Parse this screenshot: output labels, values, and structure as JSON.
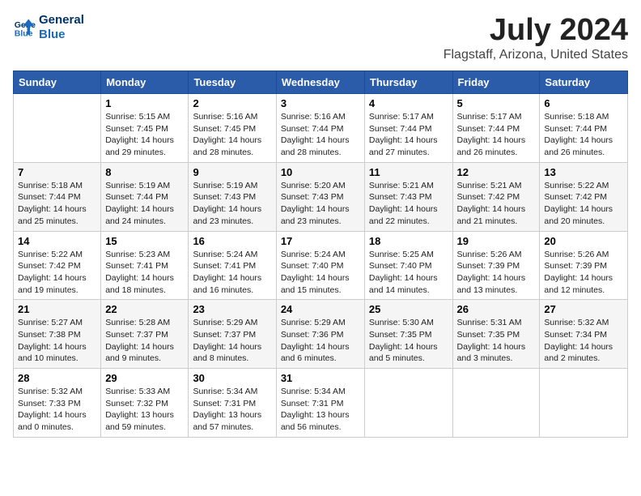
{
  "logo": {
    "line1": "General",
    "line2": "Blue"
  },
  "title": "July 2024",
  "subtitle": "Flagstaff, Arizona, United States",
  "days_of_week": [
    "Sunday",
    "Monday",
    "Tuesday",
    "Wednesday",
    "Thursday",
    "Friday",
    "Saturday"
  ],
  "weeks": [
    [
      {
        "day": "",
        "info": ""
      },
      {
        "day": "1",
        "info": "Sunrise: 5:15 AM\nSunset: 7:45 PM\nDaylight: 14 hours\nand 29 minutes."
      },
      {
        "day": "2",
        "info": "Sunrise: 5:16 AM\nSunset: 7:45 PM\nDaylight: 14 hours\nand 28 minutes."
      },
      {
        "day": "3",
        "info": "Sunrise: 5:16 AM\nSunset: 7:44 PM\nDaylight: 14 hours\nand 28 minutes."
      },
      {
        "day": "4",
        "info": "Sunrise: 5:17 AM\nSunset: 7:44 PM\nDaylight: 14 hours\nand 27 minutes."
      },
      {
        "day": "5",
        "info": "Sunrise: 5:17 AM\nSunset: 7:44 PM\nDaylight: 14 hours\nand 26 minutes."
      },
      {
        "day": "6",
        "info": "Sunrise: 5:18 AM\nSunset: 7:44 PM\nDaylight: 14 hours\nand 26 minutes."
      }
    ],
    [
      {
        "day": "7",
        "info": "Sunrise: 5:18 AM\nSunset: 7:44 PM\nDaylight: 14 hours\nand 25 minutes."
      },
      {
        "day": "8",
        "info": "Sunrise: 5:19 AM\nSunset: 7:44 PM\nDaylight: 14 hours\nand 24 minutes."
      },
      {
        "day": "9",
        "info": "Sunrise: 5:19 AM\nSunset: 7:43 PM\nDaylight: 14 hours\nand 23 minutes."
      },
      {
        "day": "10",
        "info": "Sunrise: 5:20 AM\nSunset: 7:43 PM\nDaylight: 14 hours\nand 23 minutes."
      },
      {
        "day": "11",
        "info": "Sunrise: 5:21 AM\nSunset: 7:43 PM\nDaylight: 14 hours\nand 22 minutes."
      },
      {
        "day": "12",
        "info": "Sunrise: 5:21 AM\nSunset: 7:42 PM\nDaylight: 14 hours\nand 21 minutes."
      },
      {
        "day": "13",
        "info": "Sunrise: 5:22 AM\nSunset: 7:42 PM\nDaylight: 14 hours\nand 20 minutes."
      }
    ],
    [
      {
        "day": "14",
        "info": "Sunrise: 5:22 AM\nSunset: 7:42 PM\nDaylight: 14 hours\nand 19 minutes."
      },
      {
        "day": "15",
        "info": "Sunrise: 5:23 AM\nSunset: 7:41 PM\nDaylight: 14 hours\nand 18 minutes."
      },
      {
        "day": "16",
        "info": "Sunrise: 5:24 AM\nSunset: 7:41 PM\nDaylight: 14 hours\nand 16 minutes."
      },
      {
        "day": "17",
        "info": "Sunrise: 5:24 AM\nSunset: 7:40 PM\nDaylight: 14 hours\nand 15 minutes."
      },
      {
        "day": "18",
        "info": "Sunrise: 5:25 AM\nSunset: 7:40 PM\nDaylight: 14 hours\nand 14 minutes."
      },
      {
        "day": "19",
        "info": "Sunrise: 5:26 AM\nSunset: 7:39 PM\nDaylight: 14 hours\nand 13 minutes."
      },
      {
        "day": "20",
        "info": "Sunrise: 5:26 AM\nSunset: 7:39 PM\nDaylight: 14 hours\nand 12 minutes."
      }
    ],
    [
      {
        "day": "21",
        "info": "Sunrise: 5:27 AM\nSunset: 7:38 PM\nDaylight: 14 hours\nand 10 minutes."
      },
      {
        "day": "22",
        "info": "Sunrise: 5:28 AM\nSunset: 7:37 PM\nDaylight: 14 hours\nand 9 minutes."
      },
      {
        "day": "23",
        "info": "Sunrise: 5:29 AM\nSunset: 7:37 PM\nDaylight: 14 hours\nand 8 minutes."
      },
      {
        "day": "24",
        "info": "Sunrise: 5:29 AM\nSunset: 7:36 PM\nDaylight: 14 hours\nand 6 minutes."
      },
      {
        "day": "25",
        "info": "Sunrise: 5:30 AM\nSunset: 7:35 PM\nDaylight: 14 hours\nand 5 minutes."
      },
      {
        "day": "26",
        "info": "Sunrise: 5:31 AM\nSunset: 7:35 PM\nDaylight: 14 hours\nand 3 minutes."
      },
      {
        "day": "27",
        "info": "Sunrise: 5:32 AM\nSunset: 7:34 PM\nDaylight: 14 hours\nand 2 minutes."
      }
    ],
    [
      {
        "day": "28",
        "info": "Sunrise: 5:32 AM\nSunset: 7:33 PM\nDaylight: 14 hours\nand 0 minutes."
      },
      {
        "day": "29",
        "info": "Sunrise: 5:33 AM\nSunset: 7:32 PM\nDaylight: 13 hours\nand 59 minutes."
      },
      {
        "day": "30",
        "info": "Sunrise: 5:34 AM\nSunset: 7:31 PM\nDaylight: 13 hours\nand 57 minutes."
      },
      {
        "day": "31",
        "info": "Sunrise: 5:34 AM\nSunset: 7:31 PM\nDaylight: 13 hours\nand 56 minutes."
      },
      {
        "day": "",
        "info": ""
      },
      {
        "day": "",
        "info": ""
      },
      {
        "day": "",
        "info": ""
      }
    ]
  ]
}
